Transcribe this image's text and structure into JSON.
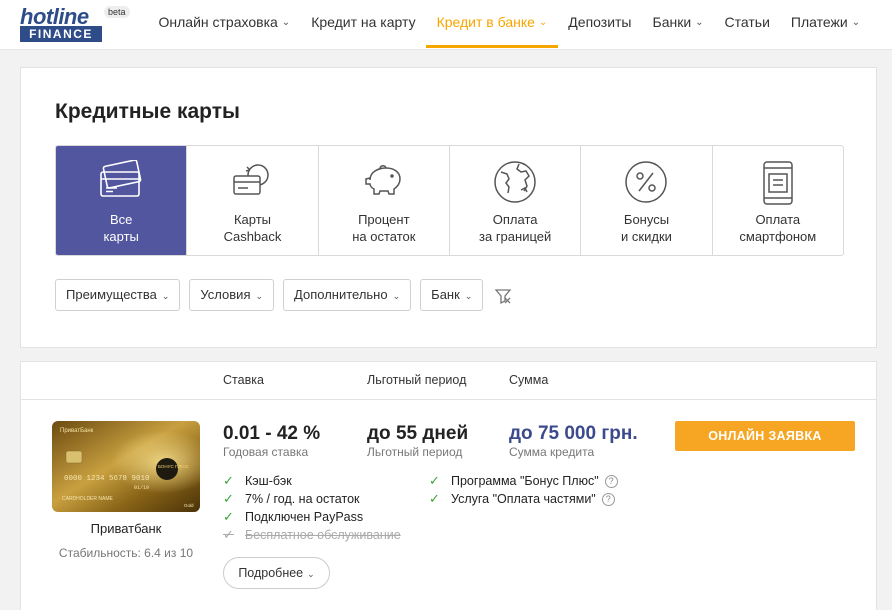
{
  "logo": {
    "top": "hotline",
    "bottom": "FINANCE",
    "badge": "beta"
  },
  "nav": [
    {
      "label": "Онлайн страховка",
      "chevron": true
    },
    {
      "label": "Кредит на карту",
      "chevron": false
    },
    {
      "label": "Кредит в банке",
      "chevron": true,
      "active": true
    },
    {
      "label": "Депозиты",
      "chevron": false
    },
    {
      "label": "Банки",
      "chevron": true
    },
    {
      "label": "Статьи",
      "chevron": false
    },
    {
      "label": "Платежи",
      "chevron": true
    }
  ],
  "page": {
    "title": "Кредитные карты"
  },
  "categories": [
    {
      "line1": "Все",
      "line2": "карты",
      "icon": "cards-icon",
      "active": true
    },
    {
      "line1": "Карты",
      "line2": "Cashback",
      "icon": "cashback-icon"
    },
    {
      "line1": "Процент",
      "line2": "на остаток",
      "icon": "piggy-bank-icon"
    },
    {
      "line1": "Оплата",
      "line2": "за границей",
      "icon": "globe-icon"
    },
    {
      "line1": "Бонусы",
      "line2": "и скидки",
      "icon": "percent-icon"
    },
    {
      "line1": "Оплата",
      "line2": "смартфоном",
      "icon": "smartphone-icon"
    }
  ],
  "filters": [
    "Преимущества",
    "Условия",
    "Дополнительно",
    "Банк"
  ],
  "columns": {
    "rate": "Ставка",
    "grace": "Льготный период",
    "sum": "Сумма"
  },
  "offer": {
    "bank": "Приватбанк",
    "stability": "Стабильность: 6.4 из 10",
    "card_text": {
      "brand": "ПриватБанк",
      "number": "0000 1234 5678 9010",
      "holder": "CARDHOLDER NAME",
      "bonus": "БОНУС ПЛЮС",
      "expiry": "01/19",
      "tier": "Gold"
    },
    "rate": "0.01 - 42 %",
    "rate_sub": "Годовая ставка",
    "grace": "до 55 дней",
    "grace_sub": "Льготный период",
    "sum": "до 75 000 грн.",
    "sum_sub": "Сумма кредита",
    "apply": "ОНЛАЙН ЗАЯВКА",
    "features_left": [
      {
        "label": "Кэш-бэк",
        "enabled": true
      },
      {
        "label": "7% / год. на остаток",
        "enabled": true
      },
      {
        "label": "Подключен PayPass",
        "enabled": true
      },
      {
        "label": "Бесплатное обслуживание",
        "enabled": false
      }
    ],
    "features_right": [
      {
        "label": "Программа \"Бонус Плюс\"",
        "enabled": true,
        "help": true
      },
      {
        "label": "Услуга \"Оплата частями\"",
        "enabled": true,
        "help": true
      }
    ],
    "more": "Подробнее"
  },
  "colors": {
    "accent": "#f7a600",
    "brand": "#2d4c88",
    "tile_active": "#52569f",
    "apply": "#f7a623",
    "check": "#3aa43a"
  }
}
